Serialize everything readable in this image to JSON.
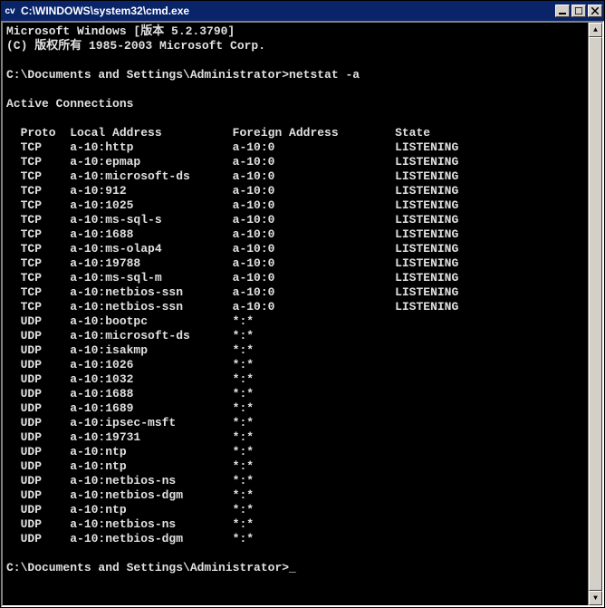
{
  "window": {
    "title": "C:\\WINDOWS\\system32\\cmd.exe",
    "icon_label": "cv"
  },
  "terminal": {
    "banner1": "Microsoft Windows [版本 5.2.3790]",
    "banner2": "(C) 版权所有 1985-2003 Microsoft Corp.",
    "prompt_path": "C:\\Documents and Settings\\Administrator>",
    "command": "netstat -a",
    "section_title": "Active Connections",
    "headers": {
      "proto": "Proto",
      "local": "Local Address",
      "foreign": "Foreign Address",
      "state": "State"
    },
    "rows": [
      {
        "proto": "TCP",
        "local": "a-10:http",
        "foreign": "a-10:0",
        "state": "LISTENING"
      },
      {
        "proto": "TCP",
        "local": "a-10:epmap",
        "foreign": "a-10:0",
        "state": "LISTENING"
      },
      {
        "proto": "TCP",
        "local": "a-10:microsoft-ds",
        "foreign": "a-10:0",
        "state": "LISTENING"
      },
      {
        "proto": "TCP",
        "local": "a-10:912",
        "foreign": "a-10:0",
        "state": "LISTENING"
      },
      {
        "proto": "TCP",
        "local": "a-10:1025",
        "foreign": "a-10:0",
        "state": "LISTENING"
      },
      {
        "proto": "TCP",
        "local": "a-10:ms-sql-s",
        "foreign": "a-10:0",
        "state": "LISTENING"
      },
      {
        "proto": "TCP",
        "local": "a-10:1688",
        "foreign": "a-10:0",
        "state": "LISTENING"
      },
      {
        "proto": "TCP",
        "local": "a-10:ms-olap4",
        "foreign": "a-10:0",
        "state": "LISTENING"
      },
      {
        "proto": "TCP",
        "local": "a-10:19788",
        "foreign": "a-10:0",
        "state": "LISTENING"
      },
      {
        "proto": "TCP",
        "local": "a-10:ms-sql-m",
        "foreign": "a-10:0",
        "state": "LISTENING"
      },
      {
        "proto": "TCP",
        "local": "a-10:netbios-ssn",
        "foreign": "a-10:0",
        "state": "LISTENING"
      },
      {
        "proto": "TCP",
        "local": "a-10:netbios-ssn",
        "foreign": "a-10:0",
        "state": "LISTENING"
      },
      {
        "proto": "UDP",
        "local": "a-10:bootpc",
        "foreign": "*:*",
        "state": ""
      },
      {
        "proto": "UDP",
        "local": "a-10:microsoft-ds",
        "foreign": "*:*",
        "state": ""
      },
      {
        "proto": "UDP",
        "local": "a-10:isakmp",
        "foreign": "*:*",
        "state": ""
      },
      {
        "proto": "UDP",
        "local": "a-10:1026",
        "foreign": "*:*",
        "state": ""
      },
      {
        "proto": "UDP",
        "local": "a-10:1032",
        "foreign": "*:*",
        "state": ""
      },
      {
        "proto": "UDP",
        "local": "a-10:1688",
        "foreign": "*:*",
        "state": ""
      },
      {
        "proto": "UDP",
        "local": "a-10:1689",
        "foreign": "*:*",
        "state": ""
      },
      {
        "proto": "UDP",
        "local": "a-10:ipsec-msft",
        "foreign": "*:*",
        "state": ""
      },
      {
        "proto": "UDP",
        "local": "a-10:19731",
        "foreign": "*:*",
        "state": ""
      },
      {
        "proto": "UDP",
        "local": "a-10:ntp",
        "foreign": "*:*",
        "state": ""
      },
      {
        "proto": "UDP",
        "local": "a-10:ntp",
        "foreign": "*:*",
        "state": ""
      },
      {
        "proto": "UDP",
        "local": "a-10:netbios-ns",
        "foreign": "*:*",
        "state": ""
      },
      {
        "proto": "UDP",
        "local": "a-10:netbios-dgm",
        "foreign": "*:*",
        "state": ""
      },
      {
        "proto": "UDP",
        "local": "a-10:ntp",
        "foreign": "*:*",
        "state": ""
      },
      {
        "proto": "UDP",
        "local": "a-10:netbios-ns",
        "foreign": "*:*",
        "state": ""
      },
      {
        "proto": "UDP",
        "local": "a-10:netbios-dgm",
        "foreign": "*:*",
        "state": ""
      }
    ]
  }
}
